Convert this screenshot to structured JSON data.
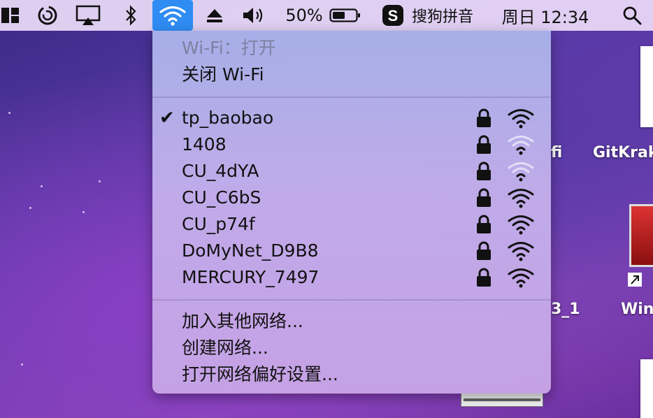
{
  "menubar": {
    "battery_percent": "50%",
    "input_method": "搜狗拼音",
    "clock": "周日 12:34"
  },
  "wifi_menu": {
    "status": "Wi-Fi：打开",
    "toggle": "关闭 Wi-Fi",
    "networks": [
      {
        "name": "tp_baobao",
        "connected": true,
        "locked": true,
        "signal": 3
      },
      {
        "name": "1408",
        "connected": false,
        "locked": true,
        "signal": 1
      },
      {
        "name": "CU_4dYA",
        "connected": false,
        "locked": true,
        "signal": 1
      },
      {
        "name": "CU_C6bS",
        "connected": false,
        "locked": true,
        "signal": 3
      },
      {
        "name": "CU_p74f",
        "connected": false,
        "locked": true,
        "signal": 3
      },
      {
        "name": "DoMyNet_D9B8",
        "connected": false,
        "locked": true,
        "signal": 3
      },
      {
        "name": "MERCURY_7497",
        "connected": false,
        "locked": true,
        "signal": 3
      }
    ],
    "actions": {
      "join_other": "加入其他网络...",
      "create": "创建网络...",
      "preferences": "打开网络偏好设置..."
    }
  },
  "desktop": {
    "label_fi": "fi",
    "label_gitkraken": "GitKrak",
    "label_3_1": "3_1",
    "label_win": "Win"
  },
  "colors": {
    "wifi_active": "#2f8cf3",
    "menu_bg": "#b9b0e6",
    "text": "#111111",
    "disabled_text": "#7d80a0"
  }
}
